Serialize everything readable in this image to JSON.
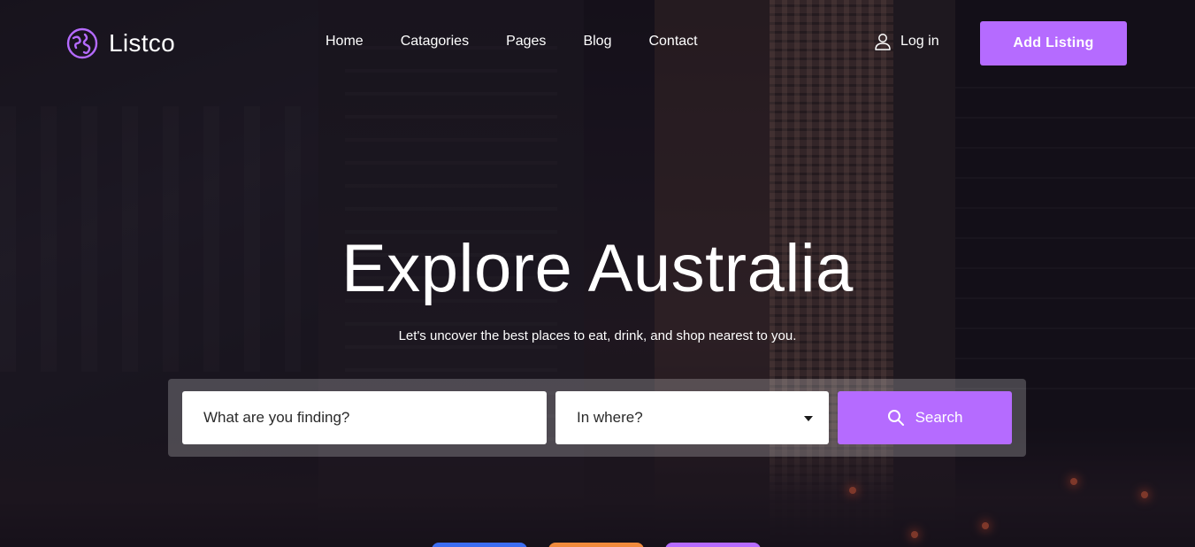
{
  "brand": {
    "name": "Listco",
    "accent": "#b56bff",
    "icon": "globe-icon"
  },
  "nav": {
    "items": [
      {
        "label": "Home"
      },
      {
        "label": "Catagories"
      },
      {
        "label": "Pages"
      },
      {
        "label": "Blog"
      },
      {
        "label": "Contact"
      }
    ]
  },
  "header": {
    "login_label": "Log in",
    "login_icon": "user-icon",
    "add_listing_label": "Add Listing"
  },
  "hero": {
    "title": "Explore Australia",
    "subtitle": "Let's uncover the best places to eat, drink, and shop nearest to you."
  },
  "search": {
    "what_placeholder": "What are you finding?",
    "where_value": "In where?",
    "button_label": "Search",
    "button_icon": "search-icon"
  },
  "category_pills": {
    "colors": [
      "#3b6df2",
      "#f08a3c",
      "#b56bff"
    ]
  }
}
